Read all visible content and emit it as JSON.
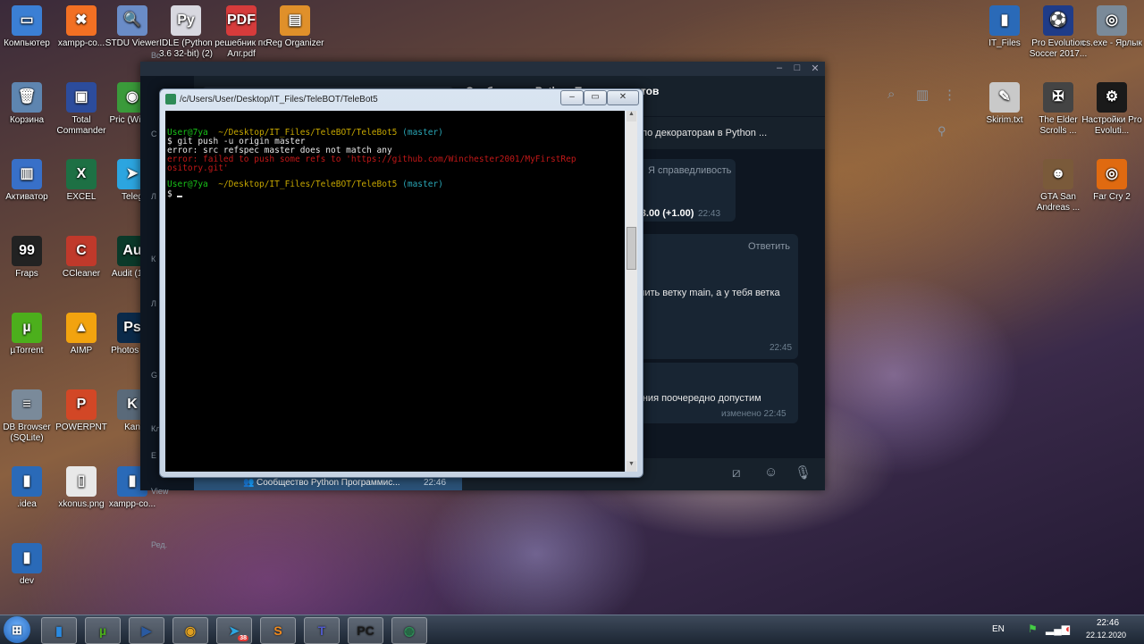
{
  "desktop_icons_left": [
    {
      "label": "Компьютер",
      "icon": "computer-icon",
      "glyph": "▭",
      "color": "#3b7fd4"
    },
    {
      "label": "xampp-co...",
      "icon": "xampp-icon",
      "glyph": "✖",
      "color": "#f27023"
    },
    {
      "label": "STDU Viewer",
      "icon": "stdu-viewer-icon",
      "glyph": "🔍",
      "color": "#6a8cc7"
    },
    {
      "label": "IDLE (Python 3.6 32-bit) (2)",
      "icon": "python-file-icon",
      "glyph": "Py",
      "color": "#d8d8e0"
    },
    {
      "label": "решебник по Алг.pdf",
      "icon": "pdf-file-icon",
      "glyph": "PDF",
      "color": "#d63b3b"
    },
    {
      "label": "Reg Organizer",
      "icon": "reg-organizer-icon",
      "glyph": "▤",
      "color": "#e0902a"
    },
    {
      "label": "Корзина",
      "icon": "recycle-bin-icon",
      "glyph": "🗑",
      "color": "#5e85b0"
    },
    {
      "label": "Total Commander",
      "icon": "floppy-icon",
      "glyph": "▣",
      "color": "#2c4c9c"
    },
    {
      "label": "Pric (Winch",
      "icon": "chrome-icon",
      "glyph": "◉",
      "color": "#3a9a3a"
    },
    {
      "label": "Активатор",
      "icon": "activator-icon",
      "glyph": "▥",
      "color": "#3870c8"
    },
    {
      "label": "EXCEL",
      "icon": "excel-icon",
      "glyph": "X",
      "color": "#1d7044"
    },
    {
      "label": "Teleg",
      "icon": "telegram-icon",
      "glyph": "➤",
      "color": "#2ca5e0"
    },
    {
      "label": "Fraps",
      "icon": "fraps-icon",
      "glyph": "99",
      "color": "#222222"
    },
    {
      "label": "CCleaner",
      "icon": "ccleaner-icon",
      "glyph": "C",
      "color": "#c0392b"
    },
    {
      "label": "Audit (1).e",
      "icon": "audition-icon",
      "glyph": "Au",
      "color": "#0b3a2a"
    },
    {
      "label": "µTorrent",
      "icon": "utorrent-icon",
      "glyph": "µ",
      "color": "#4caf1c"
    },
    {
      "label": "AIMP",
      "icon": "aimp-icon",
      "glyph": "▲",
      "color": "#f2a30f"
    },
    {
      "label": "Photos CS",
      "icon": "photoshop-icon",
      "glyph": "Ps",
      "color": "#0b2a4a"
    },
    {
      "label": "DB Browser (SQLite)",
      "icon": "database-icon",
      "glyph": "≡",
      "color": "#7a8a9a"
    },
    {
      "label": "POWERPNT",
      "icon": "powerpoint-icon",
      "glyph": "P",
      "color": "#d24726"
    },
    {
      "label": "Kan",
      "icon": "kan-icon",
      "glyph": "K",
      "color": "#5a6a7a"
    },
    {
      "label": ".idea",
      "icon": "folder-icon",
      "glyph": "▮",
      "color": "#2a6ab8"
    },
    {
      "label": "xkonus.png",
      "icon": "image-file-icon",
      "glyph": "▯",
      "color": "#e8e8e8"
    },
    {
      "label": "xampp-co...",
      "icon": "xampp-folder-icon",
      "glyph": "▮",
      "color": "#2a6ab8"
    },
    {
      "label": "dev",
      "icon": "folder-icon",
      "glyph": "▮",
      "color": "#2a6ab8"
    }
  ],
  "desktop_icons_right": [
    {
      "label": "IT_Files",
      "icon": "folder-icon",
      "glyph": "▮",
      "color": "#2a6ab8"
    },
    {
      "label": "Pro Evolution Soccer 2017...",
      "icon": "pes-icon",
      "glyph": "⚽",
      "color": "#1f3c88"
    },
    {
      "label": "cs.exe - Ярлык",
      "icon": "counter-strike-icon",
      "glyph": "◎",
      "color": "#7a8a99"
    },
    {
      "label": "Skirim.txt",
      "icon": "text-file-icon",
      "glyph": "✎",
      "color": "#c9c9c9"
    },
    {
      "label": "The Elder Scrolls ...",
      "icon": "skyrim-icon",
      "glyph": "✠",
      "color": "#444444"
    },
    {
      "label": "Настройки Pro Evoluti...",
      "icon": "pes-settings-icon",
      "glyph": "⚙",
      "color": "#1a1a1a"
    },
    {
      "label": "GTA San Andreas ...",
      "icon": "gta-icon",
      "glyph": "☻",
      "color": "#7a5a3a"
    },
    {
      "label": "Far Cry 2",
      "icon": "far-cry-icon",
      "glyph": "◎",
      "color": "#e06a10"
    }
  ],
  "telegram": {
    "chat_title": "Сообщество Python Программистов",
    "pinned_text": "о по декораторам в Python ...",
    "messages": [
      {
        "name_tag": "Я справедливость",
        "text": "о 3.00 (+1.00)",
        "time": "22:43"
      },
      {
        "reply": "Ответить",
        "text": "ушить ветку main, а у тебя ветка",
        "time": "22:45"
      },
      {
        "text": "чения поочередно допустим",
        "time": "изменено 22:45"
      }
    ],
    "bottom_chat_name": "Сообщество Python Программис...",
    "bottom_chat_time": "22:46",
    "left_letters": [
      "Вс",
      "С",
      "Л",
      "К",
      "Л",
      "G",
      "Кл",
      "Е",
      "View",
      "Ред."
    ]
  },
  "terminal": {
    "title": "/c/Users/User/Desktop/IT_Files/TeleBOT/TeleBot5",
    "prompt_user": "User@7ya",
    "prompt_path": "~/Desktop/IT_Files/TeleBOT/TeleBot5",
    "prompt_branch": "(master)",
    "command": "$ git push -u origin master",
    "error1": "error: src refspec master does not match any",
    "error2a": "error: failed to push some refs to 'https://github.com/Winchester2001/MyFirstRep",
    "error2b": "ository.git'",
    "prompt_dollar": "$"
  },
  "taskbar": {
    "items": [
      {
        "icon": "windows-start-icon",
        "glyph": "⊞",
        "color": "#2a7ad8"
      },
      {
        "icon": "explorer-icon",
        "glyph": "▮",
        "color": "#2a8ae0"
      },
      {
        "icon": "utorrent-icon",
        "glyph": "µ",
        "color": "#4caf1c"
      },
      {
        "icon": "media-player-icon",
        "glyph": "▶",
        "color": "#2a5aa0"
      },
      {
        "icon": "chrome-icon",
        "glyph": "◉",
        "color": "#e0a020"
      },
      {
        "icon": "telegram-icon",
        "glyph": "➤",
        "color": "#2ca5e0"
      },
      {
        "icon": "sublime-icon",
        "glyph": "S",
        "color": "#f28a1d"
      },
      {
        "icon": "teams-icon",
        "glyph": "T",
        "color": "#5059c9"
      },
      {
        "icon": "pycharm-icon",
        "glyph": "PC",
        "color": "#1a1a1a"
      },
      {
        "icon": "git-bash-icon",
        "glyph": "◍",
        "color": "#2e8b57"
      }
    ],
    "telegram_badge": "38",
    "lang": "EN",
    "time": "22:46",
    "date": "22.12.2020"
  }
}
